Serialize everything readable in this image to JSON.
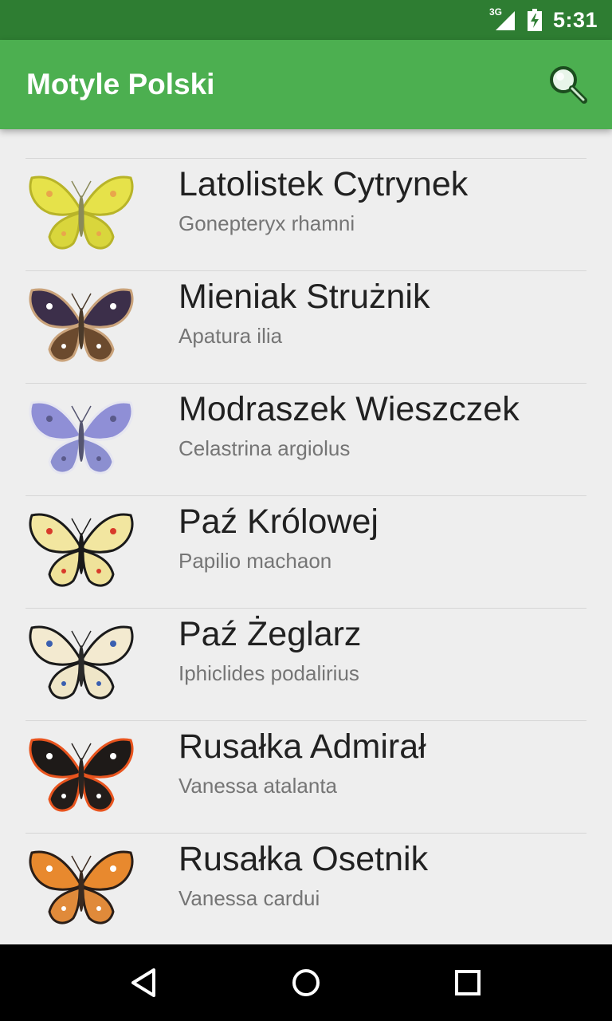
{
  "status_bar": {
    "network": "3G",
    "time": "5:31"
  },
  "app_bar": {
    "title": "Motyle Polski",
    "search_icon": "search-icon"
  },
  "butterflies": [
    {
      "name": "Latolistek Cytrynek",
      "latin": "Gonepteryx rhamni",
      "colors": {
        "wing": "#e6e24a",
        "hind": "#d9d63c",
        "edge": "#b8b428",
        "spot": "#e9a64b",
        "body": "#8a8a5a"
      }
    },
    {
      "name": "Mieniak Strużnik",
      "latin": "Apatura ilia",
      "colors": {
        "wing": "#3c2f4a",
        "hind": "#6b4a2e",
        "edge": "#c9a27a",
        "spot": "#ffffff",
        "body": "#4a3a2a"
      }
    },
    {
      "name": "Modraszek Wieszczek",
      "latin": "Celastrina argiolus",
      "colors": {
        "wing": "#8f8fd6",
        "hind": "#8c8fd0",
        "edge": "#e6e6f0",
        "spot": "#5a5a8a",
        "body": "#555570"
      }
    },
    {
      "name": "Paź Królowej",
      "latin": "Papilio machaon",
      "colors": {
        "wing": "#f2e6a0",
        "hind": "#efe29a",
        "edge": "#1a1a1a",
        "spot": "#d83a2a",
        "body": "#1a1a1a"
      }
    },
    {
      "name": "Paź Żeglarz",
      "latin": "Iphiclides podalirius",
      "colors": {
        "wing": "#f3ead0",
        "hind": "#efe6c8",
        "edge": "#1a1a1a",
        "spot": "#3a5fb0",
        "body": "#2a2a2a"
      }
    },
    {
      "name": "Rusałka Admirał",
      "latin": "Vanessa atalanta",
      "colors": {
        "wing": "#1e1a18",
        "hind": "#231d1a",
        "edge": "#e8541e",
        "spot": "#ffffff",
        "body": "#2a2420"
      }
    },
    {
      "name": "Rusałka Osetnik",
      "latin": "Vanessa cardui",
      "colors": {
        "wing": "#e8892e",
        "hind": "#e08a3a",
        "edge": "#2a1e18",
        "spot": "#ffffff",
        "body": "#3a2a20"
      }
    }
  ],
  "nav_bar": {
    "back_icon": "back-triangle-icon",
    "home_icon": "home-circle-icon",
    "recents_icon": "recents-square-icon"
  },
  "colors": {
    "status_bar": "#2e7d32",
    "app_bar": "#4caf50",
    "background": "#eeeeee",
    "name_text": "#212121",
    "latin_text": "#757575"
  }
}
